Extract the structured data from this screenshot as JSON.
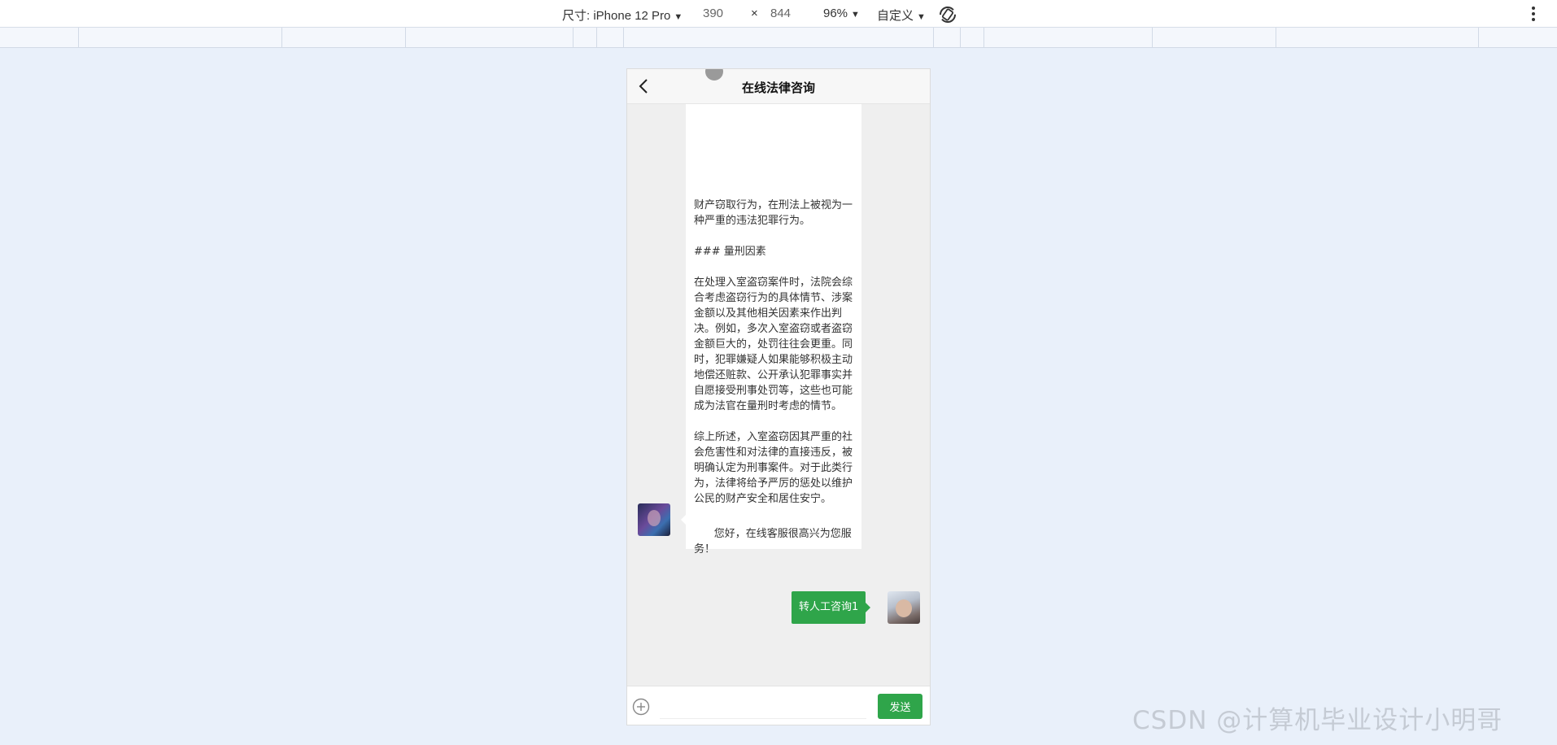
{
  "toolbar": {
    "device_label": "尺寸: iPhone 12 Pro",
    "width": "390",
    "times": "×",
    "height": "844",
    "zoom": "96%",
    "throttle": "自定义",
    "icons": [
      "chevron-down-icon",
      "rotate-icon",
      "more-vert-icon"
    ]
  },
  "phone": {
    "title": "在线法律咨询",
    "messages": {
      "long_text": "财产窃取行为，在刑法上被视为一种严重的违法犯罪行为。\n\n### 量刑因素\n\n在处理入室盗窃案件时，法院会综合考虑盗窃行为的具体情节、涉案金额以及其他相关因素来作出判决。例如，多次入室盗窃或者盗窃金额巨大的，处罚往往会更重。同时，犯罪嫌疑人如果能够积极主动地偿还赃款、公开承认犯罪事实并自愿接受刑事处罚等，这些也可能成为法官在量刑时考虑的情节。\n\n综上所述，入室盗窃因其严重的社会危害性和对法律的直接违反，被明确认定为刑事案件。对于此类行为，法律将给予严厉的惩处以维护公民的财产安全和居住安宁。",
      "greeting": "您好，在线客服很高兴为您服务！",
      "user_msg": "转人工咨询1"
    },
    "input": {
      "placeholder": "",
      "value": "",
      "send_label": "发送"
    }
  },
  "watermark": "CSDN @计算机毕业设计小明哥",
  "colors": {
    "accent_green": "#2fa54a",
    "page_bg": "#e9f0fa",
    "chat_bg": "#efefef"
  }
}
